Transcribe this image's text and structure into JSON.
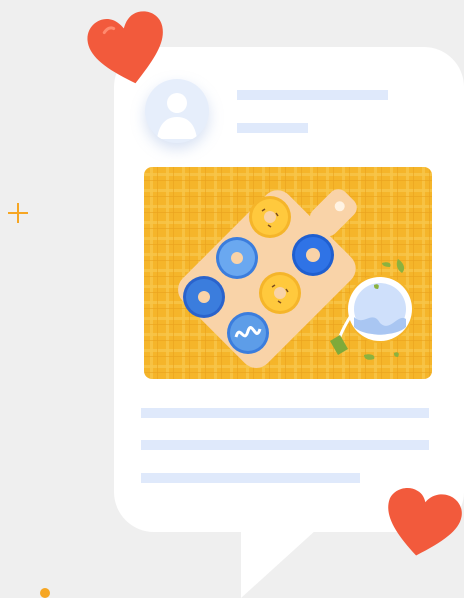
{
  "post": {
    "avatar_icon": "user-avatar-icon",
    "header_placeholders": 2,
    "image_icon": "donuts-on-cutting-board-illustration",
    "body_placeholders": 3
  },
  "decorations": {
    "hearts": [
      "heart-icon",
      "heart-icon"
    ],
    "sparkle": "plus-sparkle-icon"
  },
  "colors": {
    "placeholder": "#dfe9fb",
    "heart": "#f25a3c",
    "tablecloth": "#f5b52a",
    "sparkle": "#f6a623"
  }
}
